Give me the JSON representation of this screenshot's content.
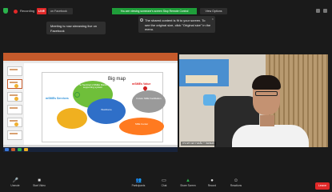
{
  "topbar": {
    "recording_label": "Recording",
    "live_badge": "LIVE",
    "live_target": "on Facebook",
    "share_notice": "You are viewing someone's screen  Stop Remote Control",
    "view_options": "View Options"
  },
  "tooltips": {
    "streaming": "Meeting is now streaming live on Facebook",
    "scaled": "The shared content is fit to your screen. To see the original size, click \"Original size\" in the menu."
  },
  "slide": {
    "title": "Big map",
    "label_left": "mSMEs Services",
    "label_right": "mSMEs Value",
    "bubble_green": "The Sentinel mSMEs Market supporting system",
    "bubble_blue": "Workforce",
    "bubble_grey": "Future SME Facilitation",
    "bubble_orange": "SME Center"
  },
  "video": {
    "participant_name": "กระทรวงการคลัง + hamuni"
  },
  "controls": [
    {
      "label": "Unmute",
      "icon": "🎤",
      "name": "unmute"
    },
    {
      "label": "Start Video",
      "icon": "■",
      "name": "start-video"
    },
    {
      "label": "Participants",
      "icon": "👥",
      "name": "participants"
    },
    {
      "label": "Chat",
      "icon": "▭",
      "name": "chat"
    },
    {
      "label": "Share Screen",
      "icon": "▲",
      "name": "share-screen"
    },
    {
      "label": "Record",
      "icon": "●",
      "name": "record"
    },
    {
      "label": "Reactions",
      "icon": "☺",
      "name": "reactions"
    }
  ],
  "end_label": "Leave",
  "colors": {
    "live_red": "#e02828",
    "share_green": "#1f9e3a",
    "background": "#1a1a1a"
  }
}
